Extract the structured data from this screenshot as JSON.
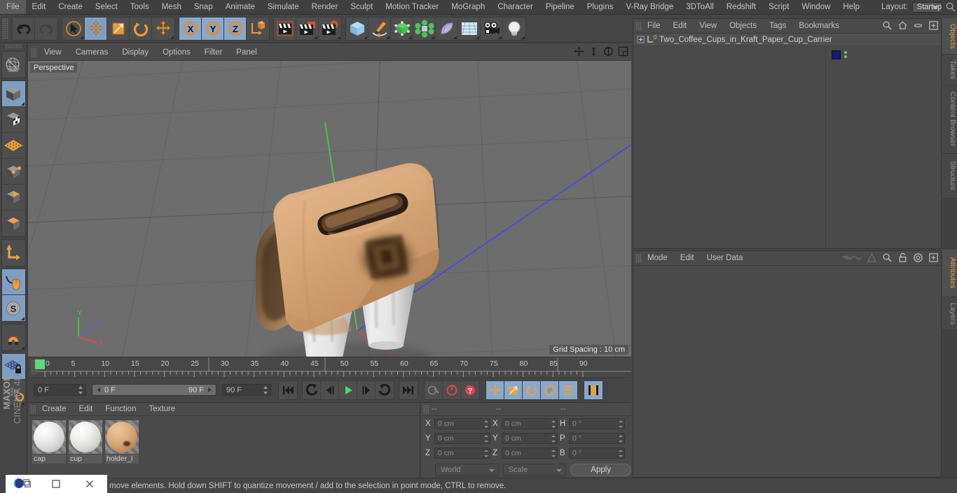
{
  "app": {
    "title": "Cinema 4D",
    "brand_top": "MAXON",
    "brand_bottom": "CINEMA 4D"
  },
  "menubar": {
    "items": [
      "File",
      "Edit",
      "Create",
      "Select",
      "Tools",
      "Mesh",
      "Snap",
      "Animate",
      "Simulate",
      "Render",
      "Sculpt",
      "Motion Tracker",
      "MoGraph",
      "Character",
      "Pipeline",
      "Plugins",
      "V-Ray Bridge",
      "3DToAll",
      "Redshift",
      "Script",
      "Window",
      "Help"
    ],
    "layout_label": "Layout:",
    "layout_value": "Startup",
    "icons": [
      "search-icon",
      "home-icon",
      "minimize-icon",
      "maximize-icon"
    ]
  },
  "toolbar": {
    "groups": [
      {
        "name": "history",
        "buttons": [
          {
            "name": "undo-button",
            "icon": "undo-arrow-icon",
            "state": "normal"
          },
          {
            "name": "redo-button",
            "icon": "redo-arrow-icon",
            "state": "disabled"
          }
        ]
      },
      {
        "name": "tools",
        "buttons": [
          {
            "name": "live-selection-tool",
            "icon": "cursor-circle-icon",
            "state": "normal"
          },
          {
            "name": "move-tool",
            "icon": "move-arrows-icon",
            "state": "active"
          },
          {
            "name": "scale-tool",
            "icon": "scale-box-icon",
            "state": "normal"
          },
          {
            "name": "rotate-tool",
            "icon": "rotate-circle-icon",
            "state": "normal"
          },
          {
            "name": "move-duplicate-tool",
            "icon": "move-arrows-icon",
            "state": "normal"
          }
        ]
      },
      {
        "name": "axis-locks",
        "buttons": [
          {
            "name": "lock-x-axis",
            "icon": "x-axis-icon",
            "state": "active"
          },
          {
            "name": "lock-y-axis",
            "icon": "y-axis-icon",
            "state": "active"
          },
          {
            "name": "lock-z-axis",
            "icon": "z-axis-icon",
            "state": "active"
          },
          {
            "name": "world-object-coords",
            "icon": "world-axis-cube-icon",
            "state": "normal"
          }
        ]
      },
      {
        "name": "render",
        "buttons": [
          {
            "name": "render-view-button",
            "icon": "clapboard-icon",
            "state": "normal"
          },
          {
            "name": "render-to-picture-viewer-button",
            "icon": "clapboard-picture-icon",
            "state": "normal"
          },
          {
            "name": "render-settings-button",
            "icon": "clapboard-gear-icon",
            "state": "normal"
          }
        ]
      },
      {
        "name": "objects",
        "buttons": [
          {
            "name": "add-cube-button",
            "icon": "blue-cube-icon",
            "state": "normal"
          },
          {
            "name": "add-spline-button",
            "icon": "pen-spline-icon",
            "state": "normal"
          },
          {
            "name": "add-nurbs-button",
            "icon": "green-cube-nurbs-icon",
            "state": "normal"
          },
          {
            "name": "add-array-button",
            "icon": "green-array-icon",
            "state": "normal"
          },
          {
            "name": "add-deformer-button",
            "icon": "bend-deformer-icon",
            "state": "normal"
          },
          {
            "name": "add-environment-button",
            "icon": "floor-grid-icon",
            "state": "normal"
          },
          {
            "name": "add-camera-button",
            "icon": "camera-icon",
            "state": "normal"
          },
          {
            "name": "add-light-button",
            "icon": "lightbulb-icon",
            "state": "normal"
          }
        ]
      }
    ]
  },
  "left_toolbar": {
    "groups": [
      {
        "name": "undo-view-group",
        "buttons": [
          {
            "name": "make-editable-button",
            "icon": "wireframe-globe-icon",
            "state": "normal"
          }
        ]
      },
      {
        "name": "mode-group",
        "buttons": [
          {
            "name": "model-mode-button",
            "icon": "grey-cube-icon",
            "state": "active"
          },
          {
            "name": "texture-mode-button",
            "icon": "checker-cube-icon",
            "state": "normal"
          },
          {
            "name": "polygon-grid-button",
            "icon": "orange-mesh-grid-icon",
            "state": "normal"
          },
          {
            "name": "point-mode-button",
            "icon": "cube-points-icon",
            "state": "normal"
          },
          {
            "name": "edge-mode-button",
            "icon": "cube-edge-icon",
            "state": "normal"
          },
          {
            "name": "polygon-mode-button",
            "icon": "cube-face-icon",
            "state": "normal"
          }
        ]
      },
      {
        "name": "axis-group",
        "buttons": [
          {
            "name": "enable-axis-modification-button",
            "icon": "orange-axis-icon",
            "state": "normal"
          }
        ]
      },
      {
        "name": "snap-group",
        "buttons": [
          {
            "name": "viewport-solo-button",
            "icon": "mouse-curve-icon",
            "state": "active"
          },
          {
            "name": "soft-selection-button",
            "icon": "s-circle-icon",
            "state": "active"
          }
        ]
      },
      {
        "name": "magnet-group",
        "buttons": [
          {
            "name": "magnet-tool-button",
            "icon": "magnet-icon",
            "state": "normal"
          }
        ]
      },
      {
        "name": "workplane-group",
        "buttons": [
          {
            "name": "lock-workplane-button",
            "icon": "grid-lock-icon",
            "state": "active"
          },
          {
            "name": "workplane-to-selection-button",
            "icon": "grid-rotate-icon",
            "state": "normal"
          }
        ]
      }
    ]
  },
  "viewport": {
    "menu": [
      "View",
      "Cameras",
      "Display",
      "Options",
      "Filter",
      "Panel"
    ],
    "label": "Perspective",
    "grid_spacing": "Grid Spacing : 10 cm",
    "right_icons": [
      "pan-view-icon",
      "zoom-view-icon",
      "rotate-view-icon",
      "maximize-view-icon"
    ],
    "axis_gizmo": {
      "x": "X",
      "y": "Y",
      "z": "Z"
    },
    "scene_description": "Two coffee cups in kraft paper cup carrier",
    "colors": {
      "background": "#6d6d6d",
      "grid_line": "#5f5f5f",
      "axis_x": "#c03a3a",
      "axis_y": "#3ec03e",
      "axis_z": "#3a3ac0",
      "kraft_paper": "#d9a978",
      "cup_white": "#e9e9e9"
    }
  },
  "timeline": {
    "ticks": [
      "0",
      "5",
      "10",
      "15",
      "20",
      "25",
      "30",
      "35",
      "40",
      "45",
      "50",
      "55",
      "60",
      "65",
      "70",
      "75",
      "80",
      "85",
      "90"
    ],
    "current_frame_marker": "0"
  },
  "transport": {
    "current_frame": "0 F",
    "range_start": "0 F",
    "range_end": "90 F",
    "preview_end": "90 F",
    "right_frame_field": "0 F",
    "buttons": [
      {
        "name": "go-to-start-button",
        "icon": "skip-start-icon"
      },
      {
        "name": "go-to-previous-key-button",
        "icon": "prev-key-icon"
      },
      {
        "name": "step-back-button",
        "icon": "step-back-icon"
      },
      {
        "name": "play-button",
        "icon": "play-icon"
      },
      {
        "name": "step-forward-button",
        "icon": "step-forward-icon"
      },
      {
        "name": "go-to-next-key-button",
        "icon": "next-key-icon"
      },
      {
        "name": "go-to-end-button",
        "icon": "skip-end-icon"
      },
      {
        "name": "record-active-objects-button",
        "icon": "key-icon"
      },
      {
        "name": "autokeying-button",
        "icon": "red-circle-icon"
      },
      {
        "name": "keyframe-selection-button",
        "icon": "red-question-icon"
      },
      {
        "name": "position-key-button",
        "icon": "orange-move-icon"
      },
      {
        "name": "scale-key-button",
        "icon": "orange-scale-icon"
      },
      {
        "name": "rotation-key-button",
        "icon": "orange-rotate-icon"
      },
      {
        "name": "param-key-button",
        "icon": "orange-p-icon"
      },
      {
        "name": "point-level-animation-button",
        "icon": "orange-dots-icon"
      },
      {
        "name": "timeline-toggle-button",
        "icon": "film-strip-icon"
      }
    ]
  },
  "material_manager": {
    "menu": [
      "Create",
      "Edit",
      "Function",
      "Texture"
    ],
    "materials": [
      {
        "name": "cap",
        "color": "#e2e2e2",
        "type": "plain"
      },
      {
        "name": "cup",
        "color": "#e6e6e2",
        "type": "plain"
      },
      {
        "name": "holder_l",
        "color": "#d7a878",
        "type": "kraft"
      }
    ]
  },
  "coordinates": {
    "headers": [
      "--",
      "--",
      "--"
    ],
    "rows": [
      {
        "axis1": "X",
        "value1": "0 cm",
        "axis2": "X",
        "value2": "0 cm",
        "axis3": "H",
        "value3": "0 °"
      },
      {
        "axis1": "Y",
        "value1": "0 cm",
        "axis2": "Y",
        "value2": "0 cm",
        "axis3": "P",
        "value3": "0 °"
      },
      {
        "axis1": "Z",
        "value1": "0 cm",
        "axis2": "Z",
        "value2": "0 cm",
        "axis3": "B",
        "value3": "0 °"
      }
    ],
    "system_dropdown": "World",
    "mode_dropdown": "Scale",
    "apply_label": "Apply"
  },
  "object_manager": {
    "menu": [
      "File",
      "Edit",
      "View",
      "Objects",
      "Tags",
      "Bookmarks"
    ],
    "right_icons": [
      "search-icon",
      "home-icon",
      "ellipse-icon",
      "add-layer-icon"
    ],
    "objects": [
      {
        "name": "Two_Coffee_Cups_in_Kraft_Paper_Cup_Carrier",
        "layer_badge": "0",
        "tag_color": "#131c6e"
      }
    ]
  },
  "attribute_manager": {
    "menu": [
      "Mode",
      "Edit",
      "User Data"
    ],
    "right_icons": [
      "interpolation-icon",
      "triangle-icon",
      "search-icon",
      "unlock-icon",
      "target-icon",
      "add-icon"
    ]
  },
  "right_tabs": [
    {
      "label": "Objects",
      "active": true
    },
    {
      "label": "Takes",
      "active": false
    },
    {
      "label": "Content Browser",
      "active": false
    },
    {
      "label": "Structure",
      "active": false
    },
    {
      "label": "Attributes",
      "active": true
    },
    {
      "label": "Layers",
      "active": false
    }
  ],
  "statusbar": {
    "text": "move elements. Hold down SHIFT to quantize movement / add to the selection in point mode, CTRL to remove.",
    "taskbar_icons": [
      "c4d-logo-icon",
      "restore-window-icon",
      "minimize-window-icon",
      "close-window-icon"
    ]
  }
}
